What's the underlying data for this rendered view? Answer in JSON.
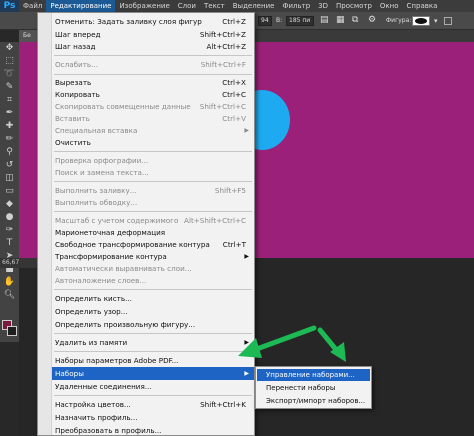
{
  "app": {
    "logo": "Ps"
  },
  "menubar": {
    "items": [
      "Файл",
      "Редактирование",
      "Изображение",
      "Слои",
      "Текст",
      "Выделение",
      "Фильтр",
      "3D",
      "Просмотр",
      "Окно",
      "Справка"
    ]
  },
  "options_bar": {
    "size_value": "94",
    "height_label": "В:",
    "height_value": "185 пи",
    "shapes_label": "Фигура:"
  },
  "document": {
    "tab_label": "Бе",
    "zoom": "66,67"
  },
  "edit_menu": {
    "items": [
      {
        "label": "Отменить: Задать заливку слоя фигур",
        "shortcut": "Ctrl+Z",
        "enabled": true
      },
      {
        "label": "Шаг вперед",
        "shortcut": "Shift+Ctrl+Z",
        "enabled": true
      },
      {
        "label": "Шаг назад",
        "shortcut": "Alt+Ctrl+Z",
        "enabled": true
      },
      {
        "label": "Ослабить...",
        "shortcut": "Shift+Ctrl+F",
        "enabled": false
      },
      {
        "label": "Вырезать",
        "shortcut": "Ctrl+X",
        "enabled": true
      },
      {
        "label": "Копировать",
        "shortcut": "Ctrl+C",
        "enabled": true
      },
      {
        "label": "Скопировать совмещенные данные",
        "shortcut": "Shift+Ctrl+C",
        "enabled": false
      },
      {
        "label": "Вставить",
        "shortcut": "Ctrl+V",
        "enabled": false
      },
      {
        "label": "Специальная вставка",
        "shortcut": "",
        "enabled": false,
        "submenu": true
      },
      {
        "label": "Очистить",
        "shortcut": "",
        "enabled": true
      },
      {
        "label": "Проверка орфографии...",
        "shortcut": "",
        "enabled": false
      },
      {
        "label": "Поиск и замена текста...",
        "shortcut": "",
        "enabled": false
      },
      {
        "label": "Выполнить заливку...",
        "shortcut": "Shift+F5",
        "enabled": false
      },
      {
        "label": "Выполнить обводку...",
        "shortcut": "",
        "enabled": false
      },
      {
        "label": "Масштаб с учетом содержимого",
        "shortcut": "Alt+Shift+Ctrl+C",
        "enabled": false
      },
      {
        "label": "Марионеточная деформация",
        "shortcut": "",
        "enabled": true
      },
      {
        "label": "Свободное трансформирование контура",
        "shortcut": "Ctrl+T",
        "enabled": true
      },
      {
        "label": "Трансформирование контура",
        "shortcut": "",
        "enabled": true,
        "submenu": true
      },
      {
        "label": "Автоматически выравнивать слои...",
        "shortcut": "",
        "enabled": false
      },
      {
        "label": "Автоналожение слоев...",
        "shortcut": "",
        "enabled": false
      },
      {
        "label": "Определить кисть...",
        "shortcut": "",
        "enabled": true
      },
      {
        "label": "Определить узор...",
        "shortcut": "",
        "enabled": true
      },
      {
        "label": "Определить произвольную фигуру...",
        "shortcut": "",
        "enabled": true
      },
      {
        "label": "Удалить из памяти",
        "shortcut": "",
        "enabled": true,
        "submenu": true
      },
      {
        "label": "Наборы параметров Adobe PDF...",
        "shortcut": "",
        "enabled": true
      },
      {
        "label": "Наборы",
        "shortcut": "",
        "enabled": true,
        "submenu": true,
        "highlighted": true
      },
      {
        "label": "Удаленные соединения...",
        "shortcut": "",
        "enabled": true
      },
      {
        "label": "Настройка цветов...",
        "shortcut": "Shift+Ctrl+K",
        "enabled": true
      },
      {
        "label": "Назначить профиль...",
        "shortcut": "",
        "enabled": true
      },
      {
        "label": "Преобразовать в профиль...",
        "shortcut": "",
        "enabled": true
      }
    ]
  },
  "presets_submenu": {
    "items": [
      {
        "label": "Управление наборами...",
        "highlighted": true
      },
      {
        "label": "Перенести наборы",
        "highlighted": false
      },
      {
        "label": "Экспорт/импорт наборов...",
        "highlighted": false
      }
    ]
  },
  "colors": {
    "canvas": "#9b2079",
    "ellipse": "#1eaaf0",
    "highlight": "#1d64c4",
    "annotation_arrow": "#1db954"
  }
}
